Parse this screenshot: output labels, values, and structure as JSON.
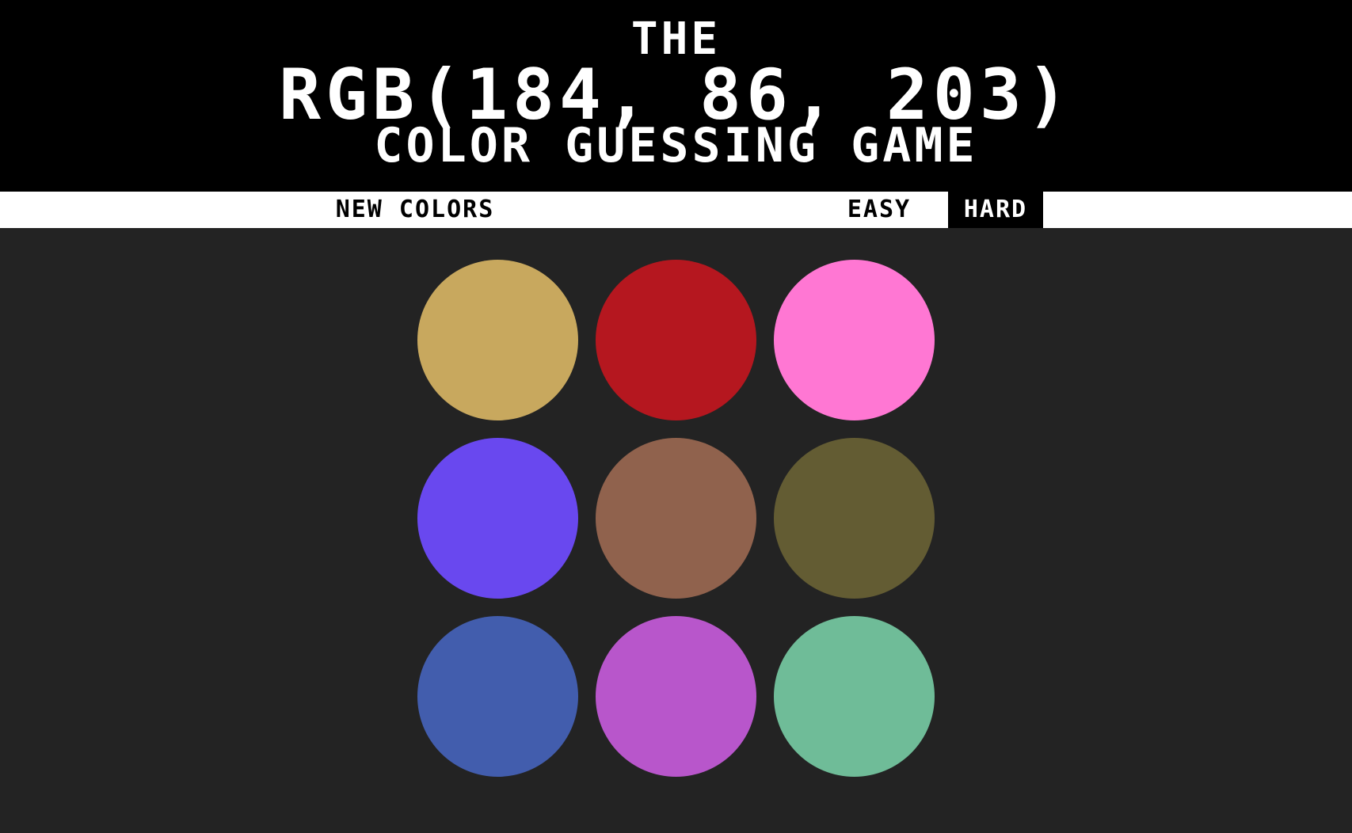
{
  "header": {
    "line1": "THE",
    "line2": "RGB(184, 86, 203)",
    "line3": "COLOR GUESSING GAME"
  },
  "controls": {
    "new_colors": "NEW COLORS",
    "message": "",
    "easy": "EASY",
    "hard": "HARD",
    "selected_mode": "HARD"
  },
  "squares": [
    {
      "color": "#c8a85e"
    },
    {
      "color": "#b5171f"
    },
    {
      "color": "#ff77d3"
    },
    {
      "color": "#6948ef"
    },
    {
      "color": "#90624d"
    },
    {
      "color": "#635c33"
    },
    {
      "color": "#425dad"
    },
    {
      "color": "#b856cb"
    },
    {
      "color": "#6fbc98"
    }
  ],
  "colors": {
    "background": "#232323",
    "header_bg": "#000000",
    "stripe_bg": "#ffffff",
    "text": "#ffffff"
  }
}
